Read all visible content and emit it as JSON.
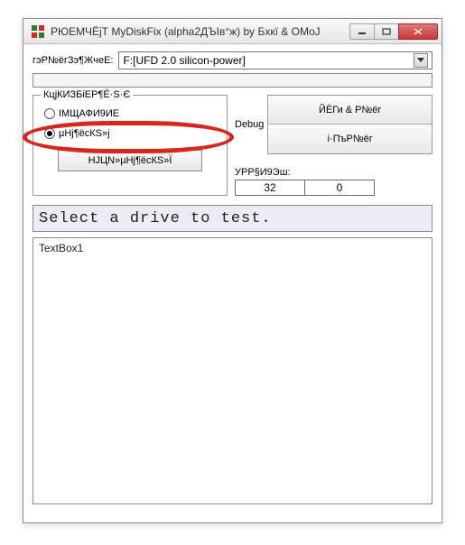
{
  "window": {
    "title": "РЮЕМЧЁјТ MyDiskFix (alpha2ДЪІв°ж) by Бхкї & OMoJ",
    "icon_colors": [
      "#2b7f2b",
      "#d6281e"
    ]
  },
  "drive": {
    "label": "гэР№ёгЗэ¶ЖчеЕ:",
    "selected": "F:[UFD 2.0 silicon-power]"
  },
  "group": {
    "title": "КцјКИЗБіЕР¶Ё·Ѕ·Є",
    "radio1": "ІМЩАФИ9ИЕ",
    "radio2": "µНј¶ёсКЅ»ј",
    "button": "НЈЦN»µНј¶ёсКЅ»Ї"
  },
  "right": {
    "debug": "Debug",
    "btn1": "ЙЁГи & Р№ёг",
    "btn2": "і·ПъР№ёг"
  },
  "stats": {
    "label": "УРР§И9Эш:",
    "val1": "32",
    "val2": "0"
  },
  "status": "Select a drive to test.",
  "textbox": "TextBox1"
}
